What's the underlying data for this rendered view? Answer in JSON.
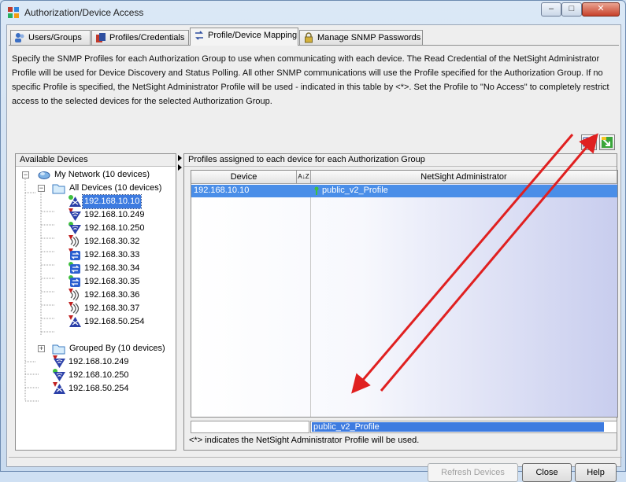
{
  "window": {
    "title": "Authorization/Device Access",
    "controls": {
      "minimize": "–",
      "maximize": "□",
      "close": "✕"
    }
  },
  "tabs": [
    {
      "label": "Users/Groups",
      "icon": "users-icon",
      "active": false
    },
    {
      "label": "Profiles/Credentials",
      "icon": "profiles-icon",
      "active": false
    },
    {
      "label": "Profile/Device Mapping",
      "icon": "mapping-icon",
      "active": true
    },
    {
      "label": "Manage SNMP Passwords",
      "icon": "lock-icon",
      "active": false
    }
  ],
  "description": "Specify the SNMP Profiles for each Authorization Group to use when communicating with each device.  The Read Credential of the NetSight Administrator Profile will be used for Device Discovery and Status Polling.  All other SNMP communications will use the Profile specified for the Authorization Group.  If no specific Profile is specified, the NetSight Administrator Profile will be used - indicated in this table by <*>.  Set the Profile to \"No Access\" to completely restrict access to the selected devices for the selected Authorization Group.",
  "left_panel": {
    "title": "Available Devices",
    "tree": {
      "root": {
        "label": "My Network (10 devices)",
        "expander": "−"
      },
      "all_devices": {
        "label": "All Devices (10 devices)",
        "expander": "−"
      },
      "devices": [
        {
          "ip": "192.168.10.10",
          "icon": "router-icon",
          "status": "green",
          "selected": true
        },
        {
          "ip": "192.168.10.249",
          "icon": "wireless-icon",
          "status": "red",
          "selected": false
        },
        {
          "ip": "192.168.10.250",
          "icon": "wireless-icon",
          "status": "green",
          "selected": false
        },
        {
          "ip": "192.168.30.32",
          "icon": "access-point-icon",
          "status": "red",
          "selected": false
        },
        {
          "ip": "192.168.30.33",
          "icon": "switch-icon",
          "status": "red",
          "selected": false
        },
        {
          "ip": "192.168.30.34",
          "icon": "switch-icon",
          "status": "green",
          "selected": false
        },
        {
          "ip": "192.168.30.35",
          "icon": "switch-icon",
          "status": "green",
          "selected": false
        },
        {
          "ip": "192.168.30.36",
          "icon": "access-point-icon",
          "status": "red",
          "selected": false
        },
        {
          "ip": "192.168.30.37",
          "icon": "access-point-icon",
          "status": "red",
          "selected": false
        },
        {
          "ip": "192.168.50.254",
          "icon": "router-icon",
          "status": "red",
          "selected": false
        }
      ],
      "grouped": {
        "label": "Grouped By (10 devices)",
        "expander": "+"
      },
      "root_devices": [
        {
          "ip": "192.168.10.249",
          "icon": "wireless-icon",
          "status": "red"
        },
        {
          "ip": "192.168.10.250",
          "icon": "wireless-icon",
          "status": "green"
        },
        {
          "ip": "192.168.50.254",
          "icon": "router-icon",
          "status": "red"
        }
      ]
    }
  },
  "right_panel": {
    "title": "Profiles assigned to each device for each Authorization Group",
    "table": {
      "columns": [
        "Device",
        "NetSight Administrator"
      ],
      "sort_indicator": "A↓Z",
      "rows": [
        {
          "device": "192.168.10.10",
          "profile": "public_v2_Profile"
        }
      ]
    },
    "editor": {
      "value": "public_v2_Profile"
    },
    "footnote": "<*> indicates the NetSight Administrator Profile will be used."
  },
  "buttons": {
    "refresh": "Refresh Devices",
    "close": "Close",
    "help": "Help"
  },
  "colors": {
    "selection": "#3d7be0",
    "status_green": "#3fbf3f",
    "status_red": "#c02020",
    "annotation_arrow": "#e02020"
  }
}
